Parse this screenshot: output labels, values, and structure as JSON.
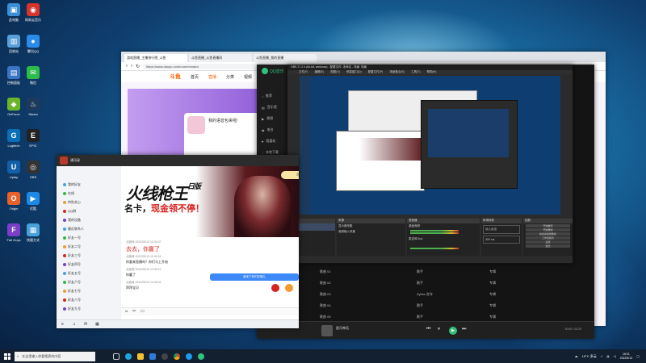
{
  "desktop": {
    "icons": [
      {
        "label": "此电脑",
        "color": "#3b8fd6",
        "glyph": "▣"
      },
      {
        "label": "网易云音乐",
        "color": "#d8342b",
        "glyph": "◉"
      },
      {
        "label": "回收站",
        "color": "#5aa0d8",
        "glyph": "▥"
      },
      {
        "label": "腾讯QQ",
        "color": "#2c8be8",
        "glyph": "●"
      },
      {
        "label": "控制面板",
        "color": "#3a74c4",
        "glyph": "▤"
      },
      {
        "label": "微信",
        "color": "#2dbb4a",
        "glyph": "✉"
      },
      {
        "label": "GeForce",
        "color": "#6cb52b",
        "glyph": "◆"
      },
      {
        "label": "Steam",
        "color": "#1d3a5c",
        "glyph": "♨"
      },
      {
        "label": "Logitech",
        "color": "#0b6fb8",
        "glyph": "G"
      },
      {
        "label": "EPIC",
        "color": "#222",
        "glyph": "E"
      },
      {
        "label": "Uplay",
        "color": "#1460a8",
        "glyph": "U"
      },
      {
        "label": "OBS",
        "color": "#333",
        "glyph": "◎"
      },
      {
        "label": "Origin",
        "color": "#e8612a",
        "glyph": "O"
      },
      {
        "label": "优酷",
        "color": "#1e88e5",
        "glyph": "▶"
      },
      {
        "label": "Fall Guys",
        "color": "#7a3ec8",
        "glyph": "F"
      },
      {
        "label": "快捷方式",
        "color": "#4aa0d8",
        "glyph": "▦"
      }
    ]
  },
  "browser": {
    "tabs": [
      "游戏直播_主播排行榜_斗鱼",
      "斗鱼直播_斗鱼直播间",
      "斗鱼直播_我的直播"
    ],
    "url": "https://www.douyu.com/room/creator",
    "logo": "斗鱼",
    "nav": [
      "首页",
      "直播",
      "分类",
      "视频",
      "游戏"
    ],
    "card_title": "我的语音包来啦!"
  },
  "qqmusic": {
    "logo": "QQ音乐",
    "sidebar": [
      "推荐",
      "音乐馆",
      "视频",
      "电台",
      "我喜欢",
      "本地下载"
    ],
    "rows": [
      {
        "title": "歌曲 01",
        "artist": "歌手",
        "album": "专辑"
      },
      {
        "title": "歌曲 02",
        "artist": "歌手",
        "album": "专辑"
      },
      {
        "title": "歌曲 03",
        "artist": "Zybss 合作",
        "album": "专辑"
      },
      {
        "title": "歌曲 04",
        "artist": "歌手",
        "album": "专辑"
      },
      {
        "title": "歌曲 05",
        "artist": "歌手",
        "album": "专辑"
      }
    ],
    "now_playing": "星月神话",
    "time": "00:00 / 03:29"
  },
  "obs": {
    "title": "OBS 27.2.4 (64-bit, windows) - 配置文件: 未命名 - 场景: 场景",
    "menu": [
      "文件(F)",
      "编辑(E)",
      "视图(V)",
      "停靠窗口(D)",
      "配置文件(P)",
      "场景集合(S)",
      "工具(T)",
      "帮助(H)"
    ],
    "docks": [
      "场景",
      "来源",
      "混音器",
      "转场特效",
      "控制"
    ],
    "scene": "场景",
    "sources": [
      "显示器采集",
      "音频输入采集"
    ],
    "mixer": [
      "桌面音频",
      "麦克风/Aux"
    ],
    "transition": "淡入淡出",
    "duration": "300 ms",
    "controls": [
      "开始推流",
      "开始录制",
      "启动虚拟摄像机",
      "工作室模式",
      "设置",
      "退出"
    ]
  },
  "qqchat": {
    "title": "通讯录",
    "ad_title": "火线枪王",
    "ad_edition": "日版",
    "ad_sub_1": "名卡，",
    "ad_sub_2": "现金领不停！",
    "ad_button": "尽享日版福利 限时领",
    "sidebar": [
      "我的好友",
      "在线",
      "特别关心",
      "QQ群",
      "我的设备",
      "最近联系人",
      "好友一号",
      "好友二号",
      "好友三号",
      "好友四号",
      "好友五号",
      "好友六号",
      "好友七号",
      "好友八号",
      "好友九号"
    ],
    "messages": [
      {
        "meta": "北极熊 2022/05/13 13:33:37",
        "text": "去去，你赢了"
      },
      {
        "meta": "北极熊 2022/05/13 13:34:01",
        "text": "你要来直播吗？你们马上开始"
      },
      {
        "meta": "北极熊 2022/05/13 13:35:11",
        "text": "你赢了"
      },
      {
        "meta": "北极熊 2022/05/13 13:36:02",
        "text": "拜拜宝贝"
      }
    ],
    "self_msg": "我来了你们在哪儿"
  },
  "taskbar": {
    "search_placeholder": "在这里输入你要搜索的内容",
    "tray_temp": "19°C 多云",
    "time": "16:01",
    "date": "2022/5/13"
  }
}
